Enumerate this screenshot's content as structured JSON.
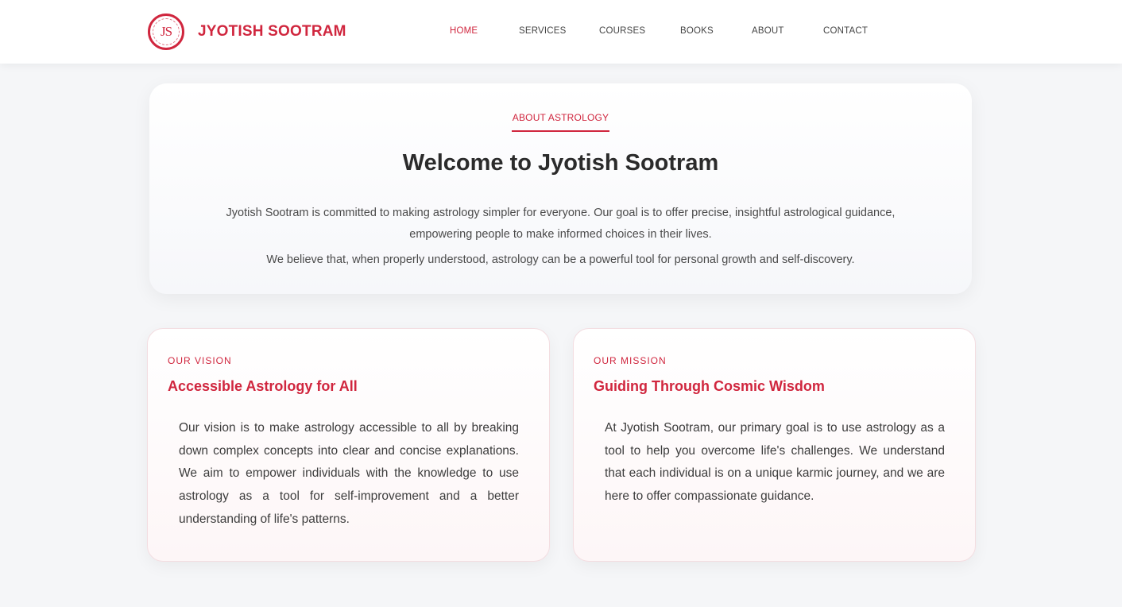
{
  "header": {
    "logo_text": "JS",
    "brand": "JYOTISH SOOTRAM",
    "nav": [
      {
        "label": "HOME"
      },
      {
        "label": "SERVICES"
      },
      {
        "label": "COURSES"
      },
      {
        "label": "BOOKS"
      },
      {
        "label": "ABOUT"
      },
      {
        "label": "CONTACT"
      }
    ],
    "active_nav": "HOME"
  },
  "about": {
    "tag": "ABOUT ASTROLOGY",
    "title": "Welcome to Jyotish Sootram",
    "paragraph1": "Jyotish Sootram is committed to making astrology simpler for everyone. Our goal is to offer precise, insightful astrological guidance, empowering people to make informed choices in their lives.",
    "paragraph2": "We believe that, when properly understood, astrology can be a powerful tool for personal growth and self-discovery."
  },
  "vision": {
    "tag": "OUR VISION",
    "title": "Accessible Astrology for All",
    "text": "Our vision is to make astrology accessible to all by breaking down complex concepts into clear and concise explanations. We aim to empower individuals with the knowledge to use astrology as a tool for self-improvement and a better understanding of life's patterns."
  },
  "mission": {
    "tag": "OUR MISSION",
    "title": "Guiding Through Cosmic Wisdom",
    "text": "At Jyotish Sootram, our primary goal is to use astrology as a tool to help you overcome life's challenges. We understand that each individual is on a unique karmic journey, and we are here to offer compassionate guidance."
  },
  "colors": {
    "accent": "#d0263e",
    "background": "#f5f6f8"
  }
}
